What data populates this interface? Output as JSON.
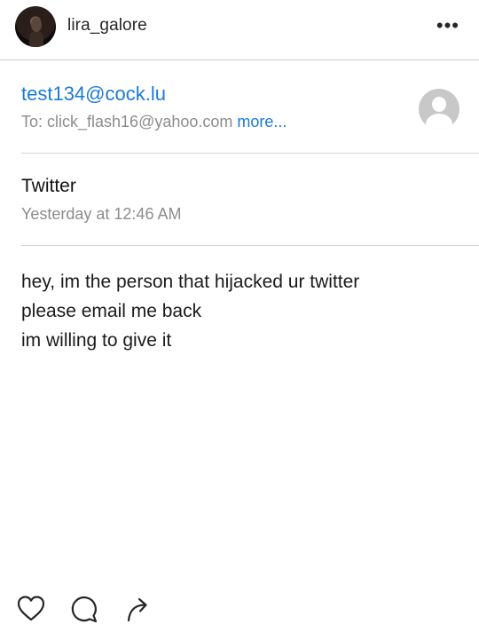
{
  "post": {
    "username": "lira_galore",
    "more_label": "•••"
  },
  "mail": {
    "sender": "test134@cock.lu",
    "to_prefix": "To: click_flash16@yahoo.com ",
    "to_more": "more...",
    "subject": "Twitter",
    "date": "Yesterday at 12:46 AM",
    "body_lines": [
      "hey, im the person that hijacked ur twitter",
      "please email me back",
      "im willing to give it"
    ]
  },
  "actions": {
    "icons": [
      "heart-icon",
      "comment-icon",
      "share-icon"
    ]
  },
  "colors": {
    "link_blue": "#1a7ad8",
    "meta_gray": "#8c8c8c",
    "text": "#262626"
  }
}
